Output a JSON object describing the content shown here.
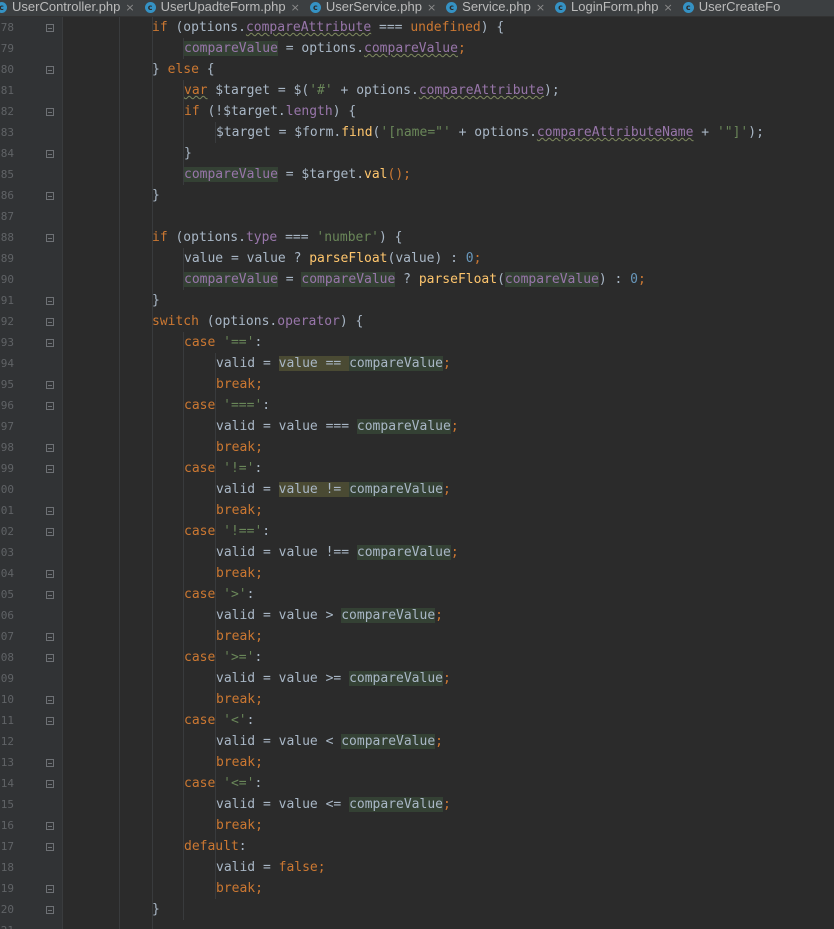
{
  "tabs": [
    {
      "label": "UserController.php",
      "icon": "class-icon"
    },
    {
      "label": "UserUpadteForm.php",
      "icon": "class-icon"
    },
    {
      "label": "UserService.php",
      "icon": "class-icon"
    },
    {
      "label": "Service.php",
      "icon": "class-icon"
    },
    {
      "label": "LoginForm.php",
      "icon": "class-icon"
    },
    {
      "label": "UserCreateFo",
      "icon": "class-icon"
    }
  ],
  "tab_icon_letter": "c",
  "tab_close_glyph": "×",
  "line_numbers": [
    "78",
    "79",
    "80",
    "81",
    "82",
    "83",
    "84",
    "85",
    "86",
    "87",
    "88",
    "89",
    "90",
    "91",
    "92",
    "93",
    "94",
    "95",
    "96",
    "97",
    "98",
    "99",
    "00",
    "01",
    "02",
    "03",
    "04",
    "05",
    "06",
    "07",
    "08",
    "09",
    "10",
    "11",
    "12",
    "13",
    "14",
    "15",
    "16",
    "17",
    "18",
    "19",
    "20",
    "21"
  ],
  "code": {
    "l78": [
      "if",
      " (options.",
      "compareAttribute",
      " === ",
      "undefined",
      ") {"
    ],
    "l79": [
      "compareValue",
      " = options.",
      "compareValue",
      ";"
    ],
    "l80": [
      "} ",
      "else",
      " {"
    ],
    "l81": [
      "var",
      " $target = $(",
      "'#'",
      " + options.",
      "compareAttribute",
      ");"
    ],
    "l82": [
      "if",
      " (!$target.",
      "length",
      ") {"
    ],
    "l83": [
      "$target = $form.",
      "find",
      "(",
      "'[name=\"'",
      " + options.",
      "compareAttributeName",
      " + ",
      "'\"]'",
      ");"
    ],
    "l84": [
      "}"
    ],
    "l85": [
      "compareValue",
      " = $target.",
      "val",
      "();"
    ],
    "l86": [
      "}"
    ],
    "l88": [
      "if",
      " (options.",
      "type",
      " === ",
      "'number'",
      ") {"
    ],
    "l89": [
      "value = value ? ",
      "parseFloat",
      "(value) : ",
      "0",
      ";"
    ],
    "l90": [
      "compareValue",
      " = ",
      "compareValue",
      " ? ",
      "parseFloat",
      "(",
      "compareValue",
      ") : ",
      "0",
      ";"
    ],
    "l91": [
      "}"
    ],
    "l92": [
      "switch",
      " (options.",
      "operator",
      ") {"
    ],
    "l93": [
      "case",
      " ",
      "'=='",
      ":"
    ],
    "l94": [
      "valid = ",
      "value == ",
      "compareValue",
      ";"
    ],
    "l95": [
      "break",
      ";"
    ],
    "l96": [
      "case",
      " ",
      "'==='",
      ":"
    ],
    "l97": [
      "valid = value === ",
      "compareValue",
      ";"
    ],
    "l98": [
      "break",
      ";"
    ],
    "l99": [
      "case",
      " ",
      "'!='",
      ":"
    ],
    "l100": [
      "valid = ",
      "value != ",
      "compareValue",
      ";"
    ],
    "l101": [
      "break",
      ";"
    ],
    "l102": [
      "case",
      " ",
      "'!=='",
      ":"
    ],
    "l103": [
      "valid = value !== ",
      "compareValue",
      ";"
    ],
    "l104": [
      "break",
      ";"
    ],
    "l105": [
      "case",
      " ",
      "'>'",
      ":"
    ],
    "l106": [
      "valid = value > ",
      "compareValue",
      ";"
    ],
    "l107": [
      "break",
      ";"
    ],
    "l108": [
      "case",
      " ",
      "'>='",
      ":"
    ],
    "l109": [
      "valid = value >= ",
      "compareValue",
      ";"
    ],
    "l110": [
      "break",
      ";"
    ],
    "l111": [
      "case",
      " ",
      "'<'",
      ":"
    ],
    "l112": [
      "valid = value < ",
      "compareValue",
      ";"
    ],
    "l113": [
      "break",
      ";"
    ],
    "l114": [
      "case",
      " ",
      "'<='",
      ":"
    ],
    "l115": [
      "valid = value <= ",
      "compareValue",
      ";"
    ],
    "l116": [
      "break",
      ";"
    ],
    "l117": [
      "default",
      ":"
    ],
    "l118": [
      "valid = ",
      "false",
      ";"
    ],
    "l119": [
      "break",
      ";"
    ],
    "l120": [
      "}"
    ]
  },
  "colors": {
    "background": "#2b2b2b",
    "gutter": "#313335",
    "keyword": "#cc7832",
    "string": "#6a8759",
    "number": "#6897bb",
    "property": "#9876aa",
    "function": "#ffc66d",
    "text": "#a9b7c6",
    "highlight": "#344134"
  }
}
